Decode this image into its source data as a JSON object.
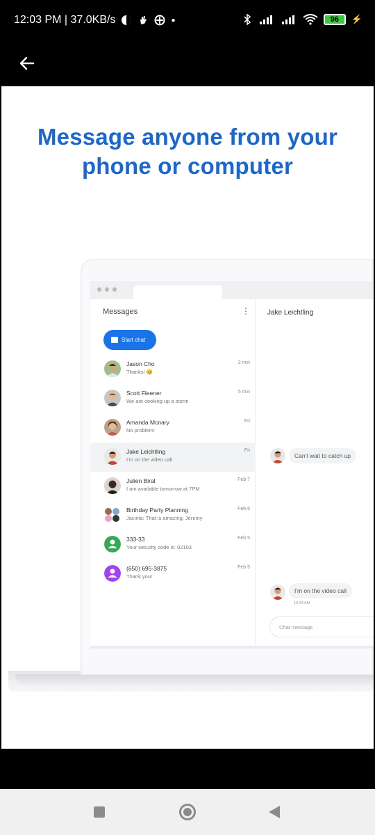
{
  "status_bar": {
    "time_speed": "12:03 PM | 37.0KB/s",
    "battery_level": "96",
    "colors": {
      "battery": "#39c839"
    }
  },
  "app_bar": {
    "back_icon": "arrow-left-icon"
  },
  "headline": {
    "line1": "Message anyone from your",
    "line2": "phone or computer",
    "color": "#1a67d2"
  },
  "messages_app": {
    "header": "Messages",
    "start_chat": "Start chat",
    "conversations": [
      {
        "name": "Jason Cho",
        "snippet": "Thanks! 😊",
        "time": "2 min",
        "avatar": "photo"
      },
      {
        "name": "Scott Fleener",
        "snippet": "We are cooking up a storm",
        "time": "5 min",
        "avatar": "photo"
      },
      {
        "name": "Amanda Mcnary",
        "snippet": "No problem!",
        "time": "Fri",
        "avatar": "photo"
      },
      {
        "name": "Jake Leichtling",
        "snippet": "I'm on the video call",
        "time": "Fri",
        "avatar": "photo",
        "selected": true
      },
      {
        "name": "Julien Biral",
        "snippet": "I am available tomorrow at 7PM",
        "time": "Feb 7",
        "avatar": "photo"
      },
      {
        "name": "Birthday Party Planning",
        "snippet": "Jacinta: That is amazing, Jeremy",
        "time": "Feb 6",
        "avatar": "group"
      },
      {
        "name": "333-33",
        "snippet": "Your security code is: 02103",
        "time": "Feb 5",
        "avatar": "green-person"
      },
      {
        "name": "(650) 695-3875",
        "snippet": "Thank you!",
        "time": "Feb 5",
        "avatar": "purple-person"
      }
    ],
    "chat": {
      "title": "Jake Leichtling",
      "messages": [
        {
          "text": "Can't wait to catch up"
        },
        {
          "text": "I'm on the video call",
          "time": "10:34 AM"
        }
      ],
      "input_placeholder": "Chat message"
    }
  },
  "nav": {
    "recents_icon": "square-icon",
    "home_icon": "circle-icon",
    "back_icon": "triangle-back-icon"
  }
}
